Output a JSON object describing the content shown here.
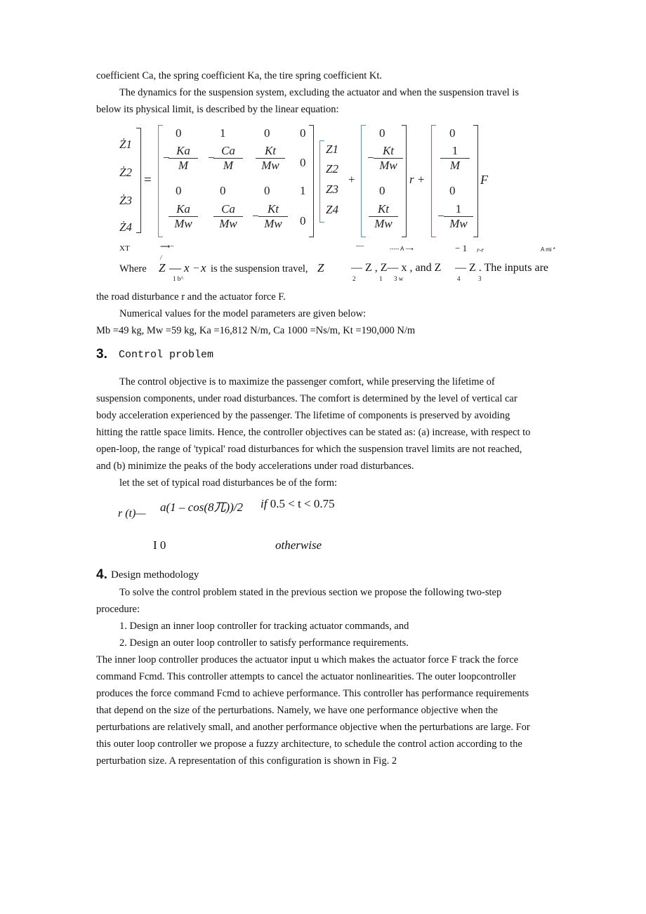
{
  "lines": {
    "l1": "coefficient Ca, the spring coefficient Ka, the tire spring coefficient Kt.",
    "l2": "The dynamics for the suspension system, excluding the actuator and when the suspension travel is",
    "l3": "below its physical limit, is described by the linear equation:"
  },
  "equation": {
    "lhs": [
      "Ż1",
      "Ż2",
      "Ż3",
      "Ż4"
    ],
    "equals": "=",
    "A": {
      "row1": [
        "0",
        "1",
        "0",
        "0"
      ],
      "row2": [
        {
          "sign": "−",
          "num": "Ka",
          "den": "M"
        },
        {
          "sign": "−",
          "num": "Ca",
          "den": "M"
        },
        {
          "sign": "",
          "num": "Kt",
          "den": "Mw"
        },
        "0"
      ],
      "row3": [
        "0",
        "0",
        "0",
        "1"
      ],
      "row4": [
        {
          "sign": "",
          "num": "Ka",
          "den": "Mw"
        },
        {
          "sign": "",
          "num": "Ca",
          "den": "Mw"
        },
        {
          "sign": "−",
          "num": "Kt",
          "den": "Mw"
        },
        "0"
      ]
    },
    "state": [
      "Z1",
      "Z2",
      "Z3",
      "Z4"
    ],
    "plus1": "+",
    "B1": [
      "0",
      {
        "sign": "−",
        "num": "Kt",
        "den": "Mw"
      },
      "0",
      {
        "sign": "",
        "num": "Kt",
        "den": "Mw"
      }
    ],
    "r_plus": "r +",
    "B2": [
      "0",
      {
        "sign": "",
        "num": "1",
        "den": "M"
      },
      "0",
      {
        "sign": "−",
        "num": "1",
        "den": "Mw"
      }
    ],
    "F": "F"
  },
  "artifacts": {
    "xt": "XT",
    "arrow1": "⟶−",
    "slash": "/",
    "dash1": "—",
    "a_arrow": "----- A ⟶",
    "minus1": "−  1",
    "rr": "r-r",
    "ami": "A mi *"
  },
  "where": {
    "where": "Where",
    "z": "Z",
    "dash": "—",
    "x1": "x",
    "dash2": "–",
    "x2": "x",
    "travel": "is the suspension travel,",
    "z2": "Z",
    "part2": "— Z , Z— x , and Z",
    "part3": "— Z . The inputs   are",
    "sub1": "1 b^",
    "sub2": "2",
    "sub3": "1",
    "sub4": "3 w",
    "sub5": "4",
    "sub6": "3"
  },
  "para1": {
    "l1": "the road disturbance r and the actuator force F.",
    "l2": "Numerical values for the model parameters are given below:",
    "l3": "Mb =49 kg, Mw =59 kg, Ka =16,812 N/m, Ca 1000 =Ns/m, Kt =190,000 N/m"
  },
  "section3": {
    "num": "3.",
    "title": "Control problem",
    "lines": [
      "The control objective is to maximize the passenger comfort, while preserving the lifetime of",
      "suspension components, under road disturbances. The comfort is determined by the level of vertical car",
      "body acceleration experienced by the passenger. The lifetime of components is preserved by avoiding",
      "hitting the rattle space limits. Hence, the controller objectives can be stated as: (a) increase, with respect to",
      "open-loop, the range of 'typical' road disturbances for which the suspension travel limits are not reached,",
      "and (b) minimize the peaks of the body accelerations under road disturbances.",
      "let the set of typical road disturbances be of the form:"
    ]
  },
  "piecewise": {
    "lhs": "r (t)—",
    "case1_expr": "a(1 – cos(8兀))/2",
    "case1_cond_if": "if",
    "case1_cond": "0.5 < t < 0.75",
    "case2_val": "I 0",
    "case2_cond": "otherwise"
  },
  "section4": {
    "num": "4.",
    "title": "Design methodology",
    "intro1": "To solve the control problem stated in the previous section we propose the following two-step",
    "intro2": "procedure:",
    "list": [
      "1.  Design an inner loop controller for tracking actuator commands, and",
      "2.  Design an outer loop controller to satisfy performance requirements."
    ],
    "body": [
      "The inner loop controller produces the actuator input u which makes the actuator force F track the force",
      "command Fcmd. This controller attempts to cancel the actuator nonlinearities. The outer loopcontroller",
      "produces the force command Fcmd to achieve performance. This controller has performance requirements",
      "that depend on the size of the perturbations. Namely, we have one performance objective when the",
      "perturbations are relatively small, and another performance objective when the perturbations are large. For",
      "this outer loop controller we propose a fuzzy architecture, to schedule the control action according to the",
      "perturbation size. A representation of this configuration is shown in Fig. 2"
    ]
  },
  "colors": {
    "text": "#111111",
    "bracket_blue": "#5a8fc0",
    "bracket_purple": "#8a6aa0"
  }
}
